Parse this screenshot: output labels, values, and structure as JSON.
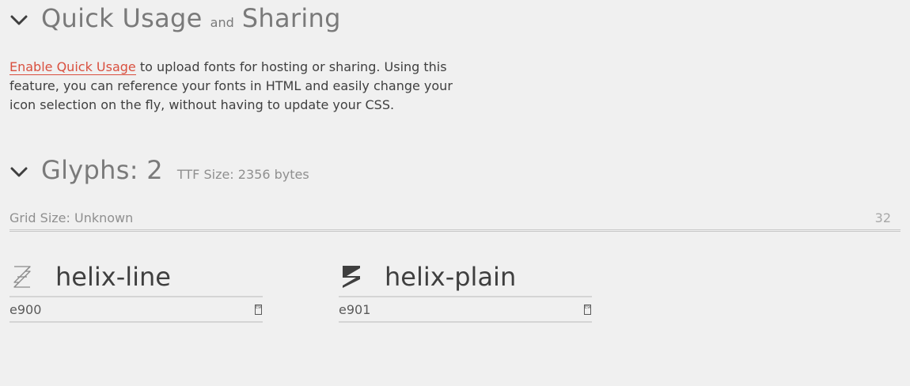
{
  "quick_usage": {
    "title_part1": "Quick Usage",
    "title_connector": "and",
    "title_part2": "Sharing",
    "enable_link": "Enable Quick Usage",
    "description": " to upload fonts for hosting or sharing. Using this feature, you can reference your fonts in HTML and easily change your icon selection on the fly, without having to update your CSS."
  },
  "glyphs_section": {
    "title": "Glyphs: 2",
    "ttf_size": "TTF Size: 2356 bytes",
    "grid_label": "Grid Size: Unknown",
    "grid_value": "32"
  },
  "glyphs": [
    {
      "name": "helix-line",
      "code": "e900",
      "code_box": "E900",
      "icon": "helix-line-icon"
    },
    {
      "name": "helix-plain",
      "code": "e901",
      "code_box": "E901",
      "icon": "helix-plain-icon"
    }
  ],
  "colors": {
    "link": "#d9503f",
    "text": "#3f3f3f",
    "heading": "#7a7a7a",
    "background": "#f0f0f0"
  }
}
